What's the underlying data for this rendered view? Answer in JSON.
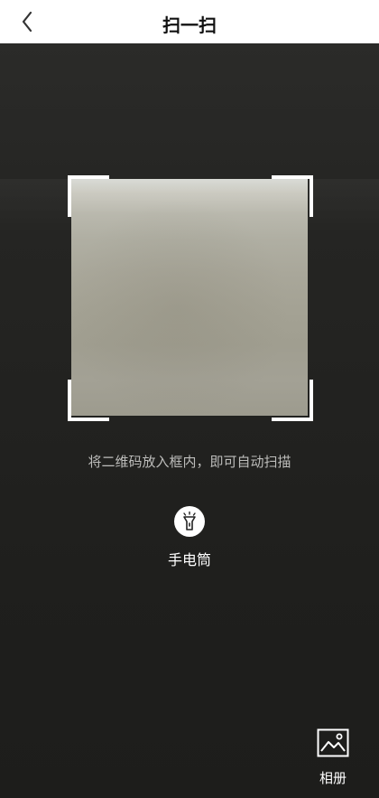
{
  "header": {
    "title": "扫一扫",
    "back_icon": "chevron-left-icon"
  },
  "scanner": {
    "hint": "将二维码放入框内，即可自动扫描",
    "torch_label": "手电筒",
    "torch_icon": "flashlight-icon"
  },
  "album": {
    "label": "相册",
    "icon": "image-icon"
  },
  "colors": {
    "header_bg": "#ffffff",
    "scene_bg": "#222220",
    "frame": "#ffffff"
  }
}
